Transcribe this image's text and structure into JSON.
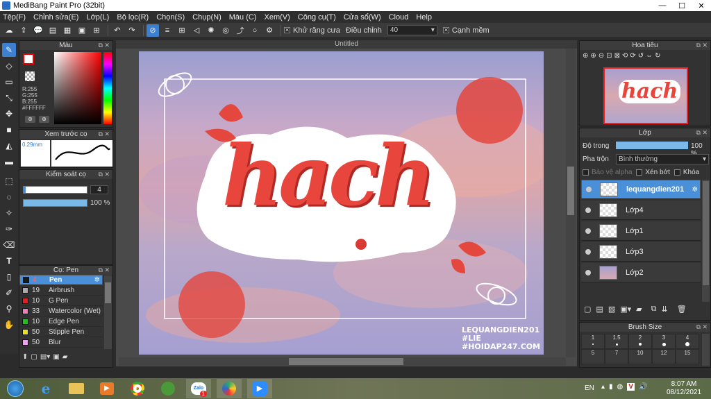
{
  "window": {
    "title": "MediBang Paint Pro (32bit)",
    "minimize": "—",
    "maximize": "☐",
    "close": "✕"
  },
  "menu": [
    "Tệp(F)",
    "Chỉnh sửa(E)",
    "Lớp(L)",
    "Bộ lọc(R)",
    "Chọn(S)",
    "Chụp(N)",
    "Màu (C)",
    "Xem(V)",
    "Công cụ(T)",
    "Cửa sổ(W)",
    "Cloud",
    "Help"
  ],
  "toolbar": {
    "antialias_label": "Khử răng cưa",
    "adjust_label": "Điều chỉnh",
    "adjust_value": "40",
    "smooth_label": "Cạnh mềm",
    "checkmark": "✕"
  },
  "color_panel": {
    "title": "Màu",
    "rgb": [
      "R:255",
      "G:255",
      "B:255"
    ],
    "hex": "#FFFFFF",
    "primary": "#ffffff",
    "secondary": "#ff0000"
  },
  "preview_panel": {
    "title": "Xem trước cọ",
    "size": "0.29mm"
  },
  "control_panel": {
    "title": "Kiểm soát cọ",
    "size_value": "4",
    "opacity_value": "100 %",
    "opacity_fraction": 1.0
  },
  "brush_panel": {
    "title": "Cọ: Pen",
    "items": [
      {
        "size": "4",
        "name": "Pen",
        "color": "#1a1a1a",
        "selected": true
      },
      {
        "size": "19",
        "name": "Airbrush",
        "color": "#aaaaaa"
      },
      {
        "size": "10",
        "name": "G Pen",
        "color": "#e02020"
      },
      {
        "size": "33",
        "name": "Watercolor (Wet)",
        "color": "#e880b8"
      },
      {
        "size": "10",
        "name": "Edge Pen",
        "color": "#20c020"
      },
      {
        "size": "50",
        "name": "Stipple Pen",
        "color": "#e8e020"
      },
      {
        "size": "50",
        "name": "Blur",
        "color": "#f0a0f0"
      }
    ]
  },
  "canvas": {
    "doc_title": "Untitled",
    "art_text": "hach",
    "watermark": [
      "LEQUANGDIEN201",
      "#LIE",
      "#HOIDAP247.COM"
    ]
  },
  "navigator": {
    "title": "Hoa tiêu"
  },
  "layer_panel": {
    "title": "Lớp",
    "opacity_label": "Độ trong",
    "opacity_value": "100 %",
    "blend_label": "Pha trộn",
    "blend_value": "Bình thường",
    "protect_alpha": "Bảo vệ alpha",
    "clipping": "Xén bớt",
    "lock": "Khóa",
    "layers": [
      {
        "name": "lequangdien201",
        "selected": true
      },
      {
        "name": "Lớp4"
      },
      {
        "name": "Lớp1"
      },
      {
        "name": "Lớp3"
      },
      {
        "name": "Lớp2"
      }
    ]
  },
  "brush_size_panel": {
    "title": "Brush Size",
    "sizes": [
      "1",
      "1.5",
      "2",
      "3",
      "4"
    ],
    "sizes2": [
      "5",
      "7",
      "10",
      "12",
      "15"
    ]
  },
  "taskbar": {
    "lang": "EN",
    "time": "8:07 AM",
    "date": "08/12/2021",
    "badge": "1",
    "zalo": "Zalo"
  }
}
